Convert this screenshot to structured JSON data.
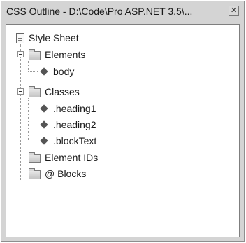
{
  "window": {
    "title": "CSS Outline - D:\\Code\\Pro ASP.NET 3.5\\...",
    "close_icon": "close-icon"
  },
  "tree": {
    "root": {
      "label": "Style Sheet",
      "icon": "stylesheet-icon"
    },
    "elements": {
      "label": "Elements",
      "expanded": true,
      "icon": "folder-icon",
      "children": [
        {
          "label": "body",
          "icon": "css-rule-icon"
        }
      ]
    },
    "classes": {
      "label": "Classes",
      "expanded": true,
      "icon": "folder-icon",
      "children": [
        {
          "label": ".heading1",
          "icon": "css-rule-icon"
        },
        {
          "label": ".heading2",
          "icon": "css-rule-icon"
        },
        {
          "label": ".blockText",
          "icon": "css-rule-icon"
        }
      ]
    },
    "element_ids": {
      "label": "Element IDs",
      "icon": "folder-icon"
    },
    "at_blocks": {
      "label": "@ Blocks",
      "icon": "folder-icon"
    }
  }
}
